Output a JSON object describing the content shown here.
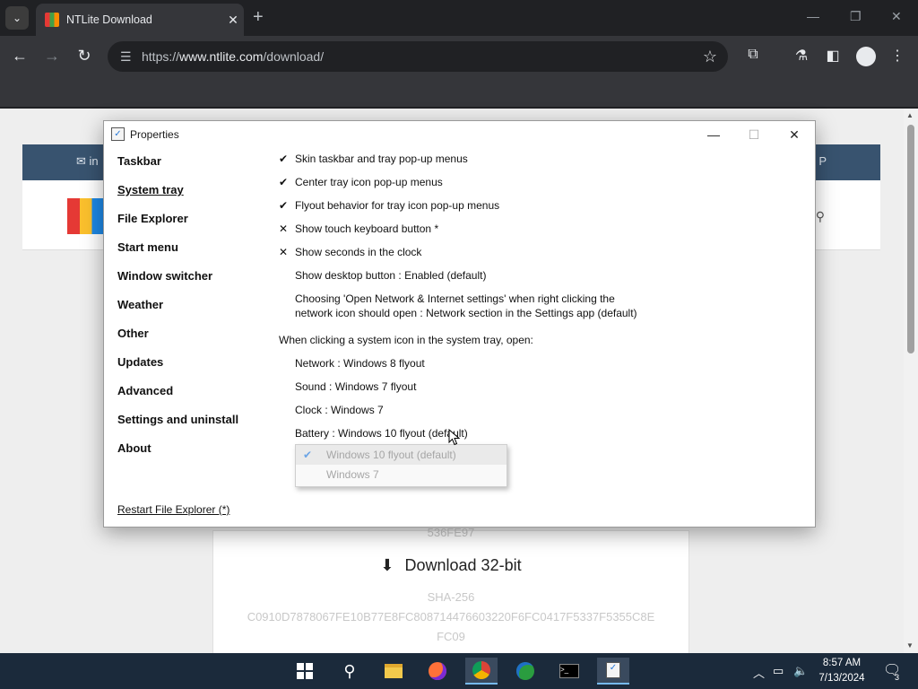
{
  "browser": {
    "tab_title": "NTLite Download",
    "url_prefix": "https://",
    "url_host": "www.ntlite.com",
    "url_path": "/download/"
  },
  "webpage": {
    "topbar_left": "in",
    "topbar_right": "P",
    "hash_above": "536FE97",
    "download_label": "Download 32-bit",
    "sha_label": "SHA-256",
    "hash_line1": "C0910D7878067FE10B77E8FC808714476603220F6FC0417F5337F5355C8E",
    "hash_line2": "FC09"
  },
  "dialog": {
    "title": "Properties",
    "sidebar": [
      "Taskbar",
      "System tray",
      "File Explorer",
      "Start menu",
      "Window switcher",
      "Weather",
      "Other",
      "Updates",
      "Advanced",
      "Settings and uninstall",
      "About"
    ],
    "active_section": "System tray",
    "restart_link": "Restart File Explorer (*)",
    "options": [
      {
        "mark": "✔",
        "text": "Skin taskbar and tray pop-up menus"
      },
      {
        "mark": "✔",
        "text": "Center tray icon pop-up menus"
      },
      {
        "mark": "✔",
        "text": "Flyout behavior for tray icon pop-up menus"
      },
      {
        "mark": "✕",
        "text": "Show touch keyboard button *"
      },
      {
        "mark": "✕",
        "text": "Show seconds in the clock"
      },
      {
        "mark": "",
        "text": "Show desktop button : Enabled (default)"
      }
    ],
    "network_option_line1": "Choosing 'Open Network & Internet settings' when right clicking the",
    "network_option_line2": "network icon should open : Network section in the Settings app (default)",
    "tray_heading": "When clicking a system icon in the system tray, open:",
    "tray_items": [
      "Network : Windows 8 flyout",
      "Sound : Windows 7 flyout",
      "Clock : Windows 7",
      "Battery : Windows 10 flyout (default)"
    ],
    "dropdown_options": [
      "Windows 10 flyout (default)",
      "Windows 7"
    ],
    "dropdown_selected_mark": "✔"
  },
  "taskbar": {
    "time": "8:57 AM",
    "date": "7/13/2024",
    "notification_count": "3"
  },
  "colors": {
    "site_topbar": "#38536f",
    "checkmark_accent": "#6ca5e6",
    "taskbar": "#1b2a3b"
  }
}
